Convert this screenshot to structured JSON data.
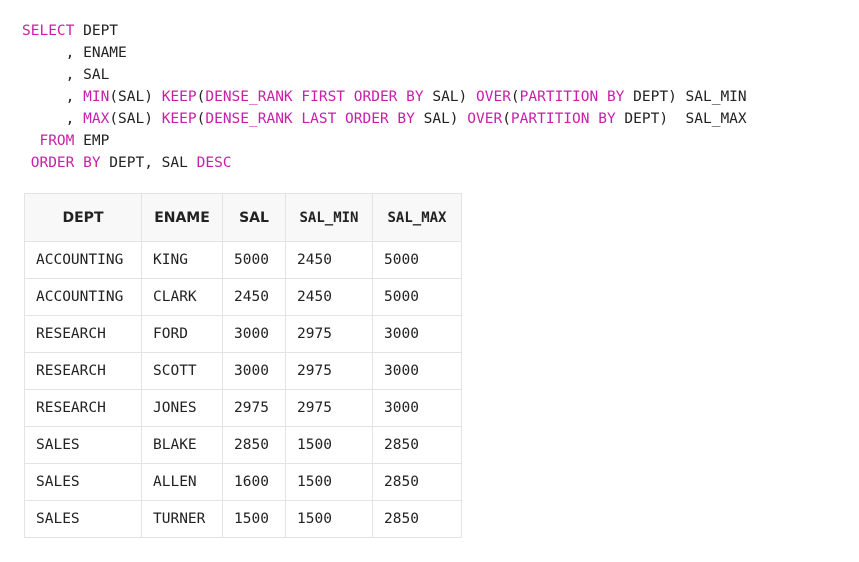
{
  "sql": {
    "lines": [
      [
        {
          "t": "SELECT",
          "k": true
        },
        {
          "t": " DEPT",
          "k": false
        }
      ],
      [
        {
          "t": "     , ENAME",
          "k": false
        }
      ],
      [
        {
          "t": "     , SAL",
          "k": false
        }
      ],
      [
        {
          "t": "     , ",
          "k": false
        },
        {
          "t": "MIN",
          "k": true
        },
        {
          "t": "(SAL) ",
          "k": false
        },
        {
          "t": "KEEP",
          "k": true
        },
        {
          "t": "(",
          "k": false
        },
        {
          "t": "DENSE_RANK FIRST ORDER BY",
          "k": true
        },
        {
          "t": " SAL) ",
          "k": false
        },
        {
          "t": "OVER",
          "k": true
        },
        {
          "t": "(",
          "k": false
        },
        {
          "t": "PARTITION BY",
          "k": true
        },
        {
          "t": " DEPT) SAL_MIN",
          "k": false
        }
      ],
      [
        {
          "t": "     , ",
          "k": false
        },
        {
          "t": "MAX",
          "k": true
        },
        {
          "t": "(SAL) ",
          "k": false
        },
        {
          "t": "KEEP",
          "k": true
        },
        {
          "t": "(",
          "k": false
        },
        {
          "t": "DENSE_RANK LAST ORDER BY",
          "k": true
        },
        {
          "t": " SAL) ",
          "k": false
        },
        {
          "t": "OVER",
          "k": true
        },
        {
          "t": "(",
          "k": false
        },
        {
          "t": "PARTITION BY",
          "k": true
        },
        {
          "t": " DEPT)  SAL_MAX",
          "k": false
        }
      ],
      [
        {
          "t": "  ",
          "k": false
        },
        {
          "t": "FROM",
          "k": true
        },
        {
          "t": " EMP",
          "k": false
        }
      ],
      [
        {
          "t": " ",
          "k": false
        },
        {
          "t": "ORDER BY",
          "k": true
        },
        {
          "t": " DEPT, SAL ",
          "k": false
        },
        {
          "t": "DESC",
          "k": true
        }
      ]
    ]
  },
  "colors": {
    "keyword": "#c81fa8",
    "text": "#222222",
    "border": "#e3e3e3"
  },
  "table": {
    "headers": {
      "dept": "DEPT",
      "ename": "ENAME",
      "sal": "SAL",
      "sal_min": "SAL_MIN",
      "sal_max": "SAL_MAX"
    },
    "rows": [
      {
        "dept": "ACCOUNTING",
        "ename": "KING",
        "sal": "5000",
        "sal_min": "2450",
        "sal_max": "5000"
      },
      {
        "dept": "ACCOUNTING",
        "ename": "CLARK",
        "sal": "2450",
        "sal_min": "2450",
        "sal_max": "5000"
      },
      {
        "dept": "RESEARCH",
        "ename": "FORD",
        "sal": "3000",
        "sal_min": "2975",
        "sal_max": "3000"
      },
      {
        "dept": "RESEARCH",
        "ename": "SCOTT",
        "sal": "3000",
        "sal_min": "2975",
        "sal_max": "3000"
      },
      {
        "dept": "RESEARCH",
        "ename": "JONES",
        "sal": "2975",
        "sal_min": "2975",
        "sal_max": "3000"
      },
      {
        "dept": "SALES",
        "ename": "BLAKE",
        "sal": "2850",
        "sal_min": "1500",
        "sal_max": "2850"
      },
      {
        "dept": "SALES",
        "ename": "ALLEN",
        "sal": "1600",
        "sal_min": "1500",
        "sal_max": "2850"
      },
      {
        "dept": "SALES",
        "ename": "TURNER",
        "sal": "1500",
        "sal_min": "1500",
        "sal_max": "2850"
      }
    ]
  }
}
